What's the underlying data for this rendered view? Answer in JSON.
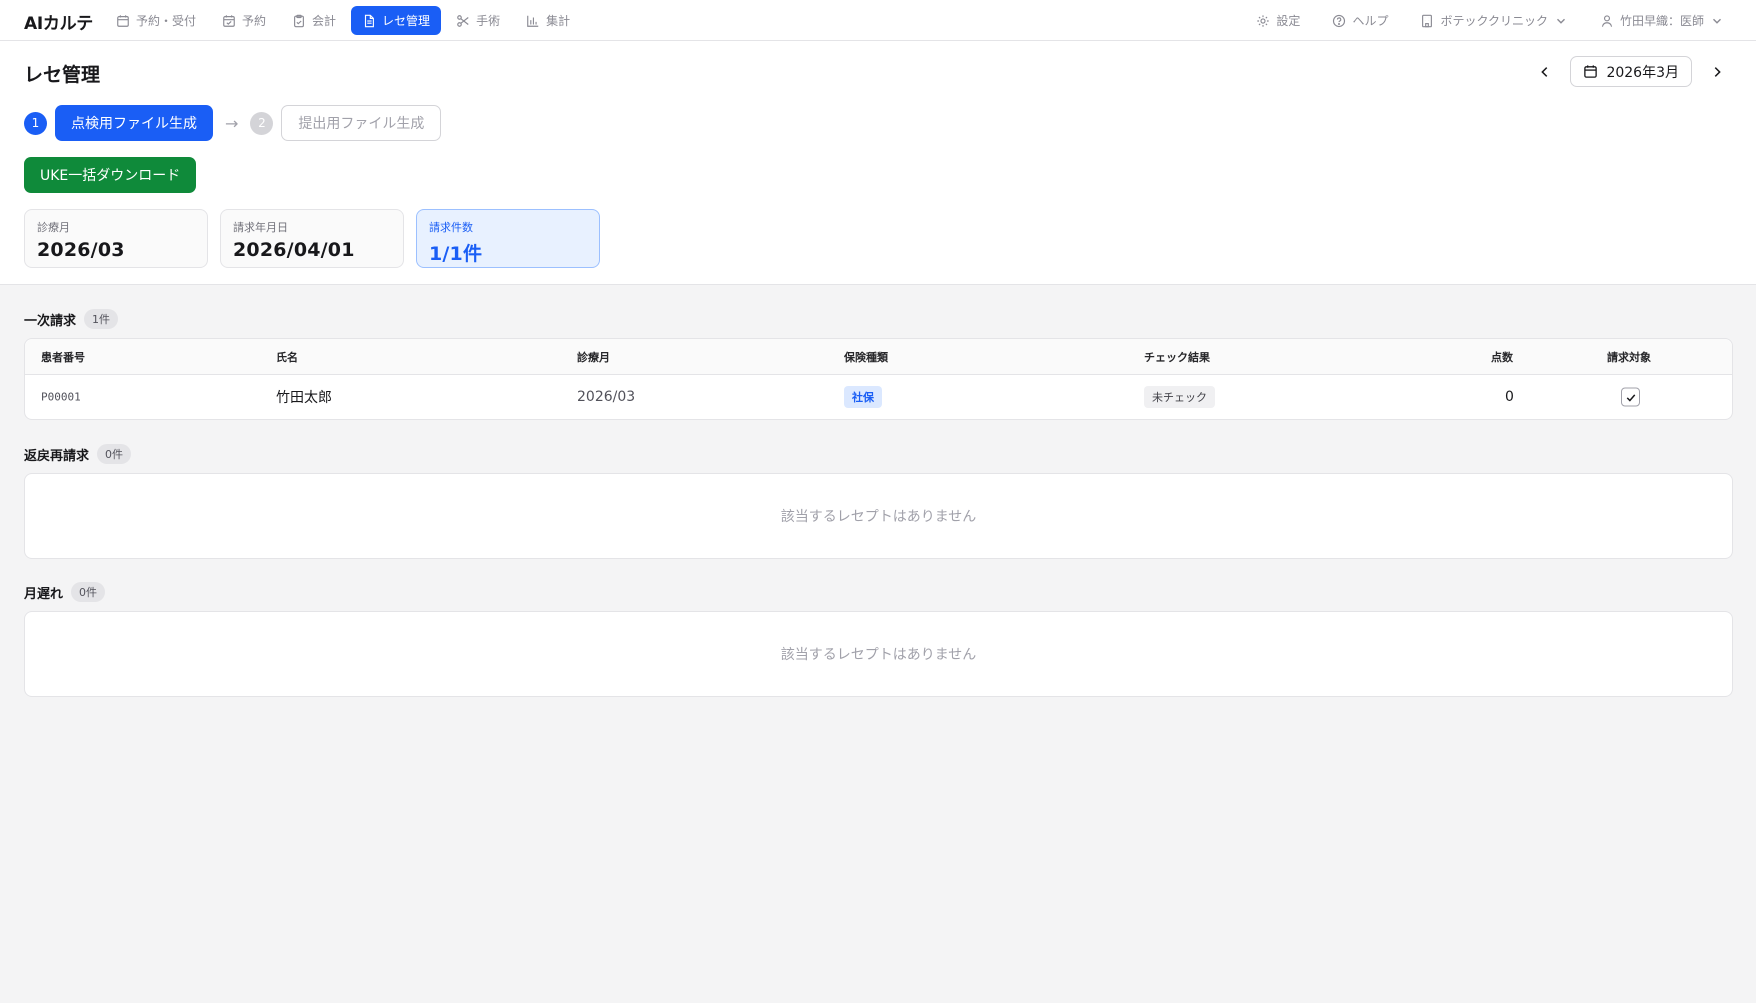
{
  "app": {
    "brand": "AIカルテ"
  },
  "nav": {
    "items": [
      {
        "label": "予約・受付",
        "icon": "calendar-icon"
      },
      {
        "label": "予約",
        "icon": "calendar-check-icon"
      },
      {
        "label": "会計",
        "icon": "clipboard-check-icon"
      },
      {
        "label": "レセ管理",
        "icon": "document-icon",
        "active": true
      },
      {
        "label": "手術",
        "icon": "scissors-icon"
      },
      {
        "label": "集計",
        "icon": "bar-chart-icon"
      }
    ],
    "right": {
      "settings": "設定",
      "help": "ヘルプ",
      "clinic": "ボテッククリニック",
      "user": "竹田早織：医師"
    }
  },
  "page": {
    "title": "レセ管理",
    "month": "2026年3月"
  },
  "steps": {
    "step1_num": "1",
    "step1_label": "点検用ファイル生成",
    "arrow": "→",
    "step2_num": "2",
    "step2_label": "提出用ファイル生成"
  },
  "actions": {
    "uke_download": "UKE一括ダウンロード"
  },
  "cards": {
    "shinryo_month_label": "診療月",
    "shinryo_month_value": "2026/03",
    "seikyu_date_label": "請求年月日",
    "seikyu_date_value": "2026/04/01",
    "seikyu_count_label": "請求件数",
    "seikyu_count_value": "1/1件"
  },
  "sections": {
    "primary": {
      "title": "一次請求",
      "count": "1件",
      "columns": [
        "患者番号",
        "氏名",
        "診療月",
        "保険種類",
        "チェック結果",
        "点数",
        "請求対象"
      ],
      "rows": [
        {
          "patient_id": "P00001",
          "name": "竹田太郎",
          "month": "2026/03",
          "insurance": "社保",
          "check": "未チェック",
          "points": "0",
          "target": true
        }
      ]
    },
    "returned": {
      "title": "返戻再請求",
      "count": "0件",
      "empty": "該当するレセプトはありません"
    },
    "late": {
      "title": "月遅れ",
      "count": "0件",
      "empty": "該当するレセプトはありません"
    }
  }
}
